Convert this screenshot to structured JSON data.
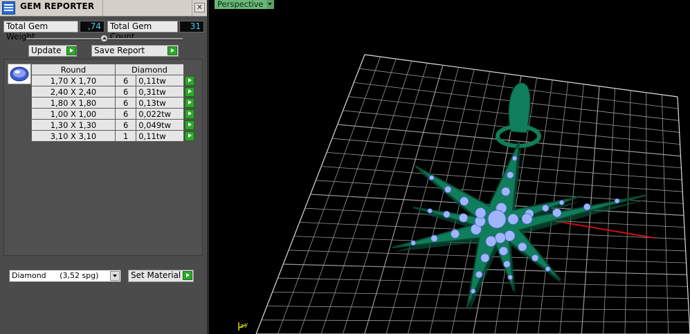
{
  "window": {
    "title": "GEM REPORTER"
  },
  "stats": {
    "weight_label": "Total Gem Weight",
    "weight_value": ",74",
    "count_label": "Total Gem Count",
    "count_value": "31"
  },
  "buttons": {
    "update": "Update",
    "save_report": "Save Report",
    "set_material": "Set Material"
  },
  "gem_table": {
    "header": {
      "shape": "Round",
      "material": "Diamond"
    },
    "rows": [
      {
        "size": "1,70 X 1,70",
        "count": "6",
        "weight": "0,11tw"
      },
      {
        "size": "2,40 X 2,40",
        "count": "6",
        "weight": "0,31tw"
      },
      {
        "size": "1,80 X 1,80",
        "count": "6",
        "weight": "0,13tw"
      },
      {
        "size": "1,00 X 1,00",
        "count": "6",
        "weight": "0,022tw"
      },
      {
        "size": "1,30 X 1,30",
        "count": "6",
        "weight": "0,049tw"
      },
      {
        "size": "3,10 X 3,10",
        "count": "1",
        "weight": "0,11tw"
      }
    ]
  },
  "material": {
    "name": "Diamond",
    "density": "(3,52 spg)"
  },
  "viewport": {
    "tab_label": "Perspective",
    "axis_labels": {
      "y": "y",
      "z": "z"
    }
  },
  "colors": {
    "panel_bg": "#4b4b4b",
    "value_text": "#3fd1ff",
    "go_button": "#2ea82a",
    "metal": "#0f7e5a",
    "gem": "#9fb6ff",
    "grid": "#c8c8c8",
    "x_axis": "#d01010",
    "viewport_tab": "#69b879"
  },
  "icons": {
    "app": "gem-reporter-icon",
    "close": "close-icon",
    "go": "play-arrow-icon",
    "dropdown": "chevron-down-icon"
  }
}
